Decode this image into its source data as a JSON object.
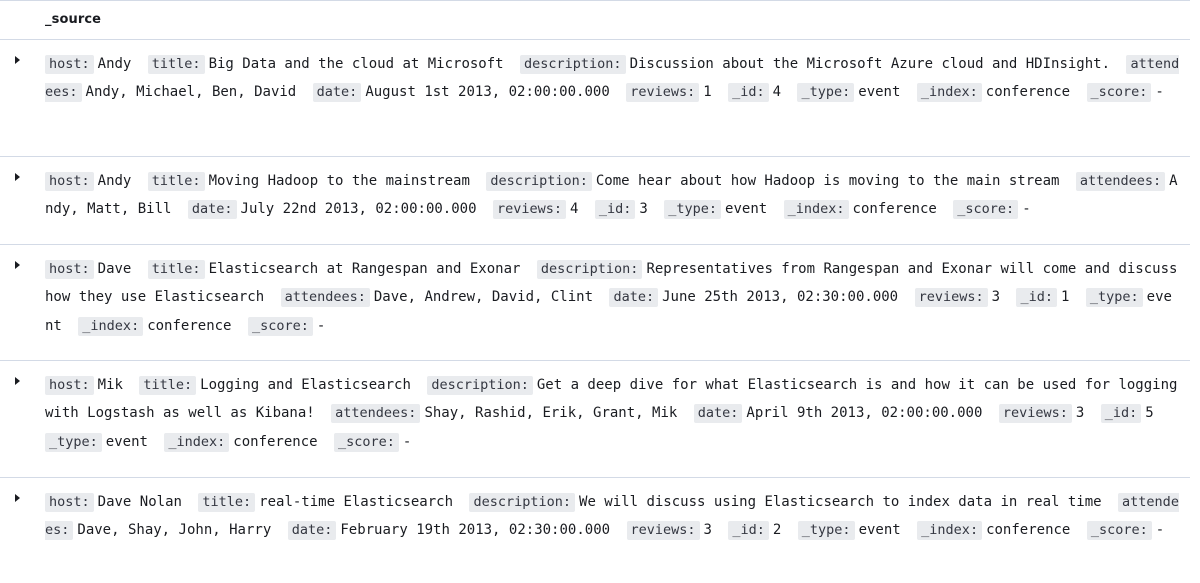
{
  "header": {
    "column_label": "_source"
  },
  "documents": [
    {
      "fields": [
        {
          "key": "host:",
          "value": "Andy"
        },
        {
          "key": "title:",
          "value": "Big Data and the cloud at Microsoft"
        },
        {
          "key": "description:",
          "value": "Discussion about the Microsoft Azure cloud and HDInsight."
        },
        {
          "key": "attendees:",
          "value": "Andy, Michael, Ben, David"
        },
        {
          "key": "date:",
          "value": "August 1st 2013, 02:00:00.000"
        },
        {
          "key": "reviews:",
          "value": "1"
        },
        {
          "key": "_id:",
          "value": "4"
        },
        {
          "key": "_type:",
          "value": "event"
        },
        {
          "key": "_index:",
          "value": "conference"
        },
        {
          "key": "_score:",
          "value": "-"
        }
      ]
    },
    {
      "fields": [
        {
          "key": "host:",
          "value": "Andy"
        },
        {
          "key": "title:",
          "value": "Moving Hadoop to the mainstream"
        },
        {
          "key": "description:",
          "value": "Come hear about how Hadoop is moving to the main stream"
        },
        {
          "key": "attendees:",
          "value": "Andy, Matt, Bill"
        },
        {
          "key": "date:",
          "value": "July 22nd 2013, 02:00:00.000"
        },
        {
          "key": "reviews:",
          "value": "4"
        },
        {
          "key": "_id:",
          "value": "3"
        },
        {
          "key": "_type:",
          "value": "event"
        },
        {
          "key": "_index:",
          "value": "conference"
        },
        {
          "key": "_score:",
          "value": "-"
        }
      ]
    },
    {
      "fields": [
        {
          "key": "host:",
          "value": "Dave"
        },
        {
          "key": "title:",
          "value": "Elasticsearch at Rangespan and Exonar"
        },
        {
          "key": "description:",
          "value": "Representatives from Rangespan and Exonar will come and discuss how they use Elasticsearch"
        },
        {
          "key": "attendees:",
          "value": "Dave, Andrew, David, Clint"
        },
        {
          "key": "date:",
          "value": "June 25th 2013, 02:30:00.000"
        },
        {
          "key": "reviews:",
          "value": "3"
        },
        {
          "key": "_id:",
          "value": "1"
        },
        {
          "key": "_type:",
          "value": "event"
        },
        {
          "key": "_index:",
          "value": "conference"
        },
        {
          "key": "_score:",
          "value": "-"
        }
      ]
    },
    {
      "fields": [
        {
          "key": "host:",
          "value": "Mik"
        },
        {
          "key": "title:",
          "value": "Logging and Elasticsearch"
        },
        {
          "key": "description:",
          "value": "Get a deep dive for what Elasticsearch is and how it can be used for logging with Logstash as well as Kibana!"
        },
        {
          "key": "attendees:",
          "value": "Shay, Rashid, Erik, Grant, Mik"
        },
        {
          "key": "date:",
          "value": "April 9th 2013, 02:00:00.000"
        },
        {
          "key": "reviews:",
          "value": "3"
        },
        {
          "key": "_id:",
          "value": "5"
        },
        {
          "key": "_type:",
          "value": "event"
        },
        {
          "key": "_index:",
          "value": "conference"
        },
        {
          "key": "_score:",
          "value": "-"
        }
      ]
    },
    {
      "fields": [
        {
          "key": "host:",
          "value": "Dave Nolan"
        },
        {
          "key": "title:",
          "value": "real-time Elasticsearch"
        },
        {
          "key": "description:",
          "value": "We will discuss using Elasticsearch to index data in real time"
        },
        {
          "key": "attendees:",
          "value": "Dave, Shay, John, Harry"
        },
        {
          "key": "date:",
          "value": "February 19th 2013, 02:30:00.000"
        },
        {
          "key": "reviews:",
          "value": "3"
        },
        {
          "key": "_id:",
          "value": "2"
        },
        {
          "key": "_type:",
          "value": "event"
        },
        {
          "key": "_index:",
          "value": "conference"
        },
        {
          "key": "_score:",
          "value": "-"
        }
      ]
    }
  ]
}
